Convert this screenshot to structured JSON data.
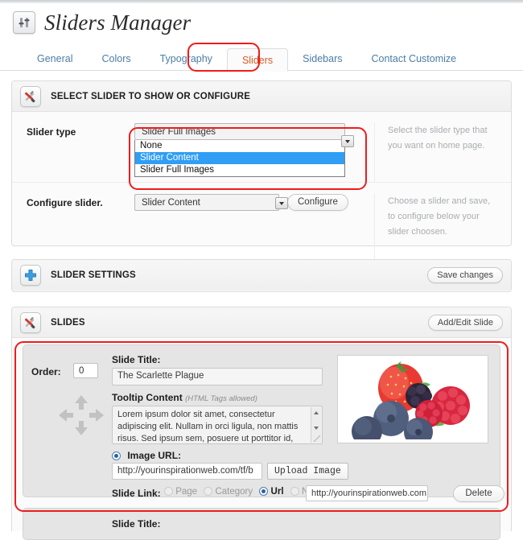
{
  "page": {
    "title": "Sliders Manager",
    "title_icon": "sliders-icon"
  },
  "tabs": [
    {
      "label": "General",
      "active": false
    },
    {
      "label": "Colors",
      "active": false
    },
    {
      "label": "Typography",
      "active": false
    },
    {
      "label": "Sliders",
      "active": true
    },
    {
      "label": "Sidebars",
      "active": false
    },
    {
      "label": "Contact Customize",
      "active": false
    }
  ],
  "select_panel": {
    "icon": "tools-icon",
    "title": "SELECT SLIDER TO SHOW OR CONFIGURE",
    "slider_type": {
      "label": "Slider type",
      "value": "Slider Full Images",
      "options": [
        "None",
        "Slider Content",
        "Slider Full Images"
      ],
      "highlighted_option": "Slider Content",
      "help": "Select the slider type that you want on home page."
    },
    "configure_slider": {
      "label": "Configure slider.",
      "value": "Slider Content",
      "button": "Configure",
      "help": "Choose a slider and save, to configure below your slider choosen."
    }
  },
  "settings_panel": {
    "icon": "plus-icon",
    "title": "SLIDER SETTINGS",
    "save_label": "Save changes"
  },
  "slides_panel": {
    "icon": "tools-icon",
    "title": "SLIDES",
    "add_edit_label": "Add/Edit Slide"
  },
  "slide": {
    "order_label": "Order:",
    "order_value": "0",
    "move_icon": "move-arrows-icon",
    "title_label": "Slide Title:",
    "title_value": "The Scarlette Plague",
    "tooltip_label": "Tooltip Content",
    "tooltip_note": "(HTML Tags allowed)",
    "tooltip_value": "Lorem ipsum dolor sit amet, consectetur adipiscing elit. Nullam in orci ligula, non mattis risus. Sed ipsum sem, posuere ut porttitor id,",
    "image_url_label": "Image URL:",
    "image_url_value": "http://yourinspirationweb.com/tf/b",
    "upload_label": "Upload Image",
    "slide_link_label": "Slide Link:",
    "link_options": [
      {
        "label": "Page",
        "selected": false
      },
      {
        "label": "Category",
        "selected": false
      },
      {
        "label": "Url",
        "selected": true
      },
      {
        "label": "None",
        "selected": false
      }
    ],
    "link_url_value": "http://yourinspirationweb.com",
    "delete_label": "Delete",
    "preview_alt": "mixed-berries-photo"
  },
  "next_slide": {
    "title_label": "Slide Title:"
  },
  "colors": {
    "accent_tab": "#d55b2a",
    "link": "#4a7da6",
    "highlight_ring": "#ee1c1c",
    "dropdown_selected": "#2f9ef4"
  }
}
